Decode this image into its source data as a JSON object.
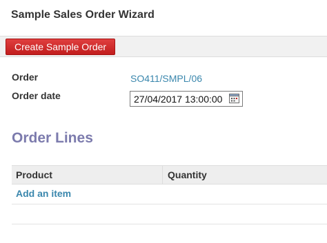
{
  "dialog": {
    "title": "Sample Sales Order Wizard"
  },
  "toolbar": {
    "create_button_label": "Create Sample Order"
  },
  "form": {
    "order_label": "Order",
    "order_value": "SO411/SMPL/06",
    "order_date_label": "Order date",
    "order_date_value": "27/04/2017 13:00:00",
    "date_picker_icon": "calendar-icon"
  },
  "order_lines": {
    "section_title": "Order Lines",
    "columns": [
      "Product",
      "Quantity"
    ],
    "add_item_label": "Add an item"
  },
  "colors": {
    "primary_button": "#c21d1d",
    "link": "#3a87ad",
    "section_title": "#7c7bad"
  }
}
